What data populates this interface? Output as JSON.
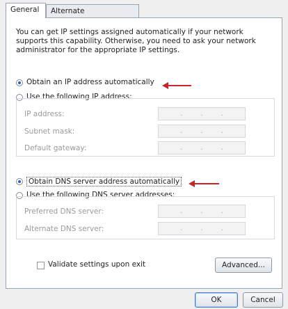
{
  "tabs": [
    {
      "label": "General",
      "active": true
    },
    {
      "label": "Alternate Configuration",
      "active": false
    }
  ],
  "description": "You can get IP settings assigned automatically if your network supports this capability. Otherwise, you need to ask your network administrator for the appropriate IP settings.",
  "ip": {
    "auto_label": "Obtain an IP address automatically",
    "manual_label": "Use the following IP address:",
    "selected": "auto",
    "fields": [
      {
        "label": "IP address:"
      },
      {
        "label": "Subnet mask:"
      },
      {
        "label": "Default gateway:"
      }
    ]
  },
  "dns": {
    "auto_label": "Obtain DNS server address automatically",
    "manual_label": "Use the following DNS server addresses:",
    "selected": "auto",
    "fields": [
      {
        "label": "Preferred DNS server:"
      },
      {
        "label": "Alternate DNS server:"
      }
    ]
  },
  "validate_label": "Validate settings upon exit",
  "advanced_label": "Advanced...",
  "ok_label": "OK",
  "cancel_label": "Cancel",
  "ip_dot": ".",
  "colors": {
    "annotation_arrow": "#c8242a",
    "radio_selected": "#2b5bbd"
  }
}
